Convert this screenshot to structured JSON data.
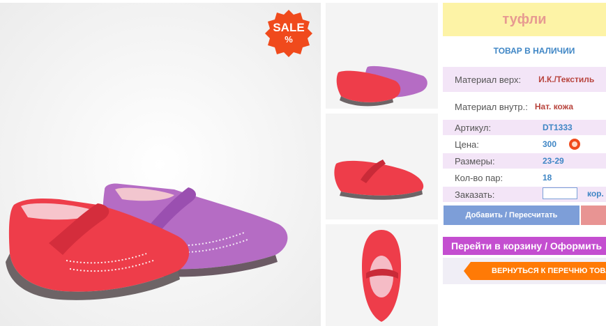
{
  "product": {
    "title": "туфли",
    "stock_status": "ТОВАР В НАЛИЧИИ"
  },
  "sale_badge": {
    "text": "SALE",
    "symbol": "%"
  },
  "specs": [
    {
      "label": "Материал верх:",
      "value": "И.К./Текстиль"
    },
    {
      "label": "Материал внутр.:",
      "value": "Нат. кожа"
    },
    {
      "label": "Артикул:",
      "value": "DT1333"
    },
    {
      "label": "Цена:",
      "value": "300"
    },
    {
      "label": "Размеры:",
      "value": "23-29"
    },
    {
      "label": "Кол-во пар:",
      "value": "18"
    }
  ],
  "order": {
    "label": "Заказать:",
    "value": "",
    "unit": "кор."
  },
  "buttons": {
    "add_recalc": "Добавить / Пересчитать",
    "go_to_cart": "Перейти в корзину / Оформить",
    "back_to_list": "ВЕРНУТЬСЯ К ПЕРЕЧНЮ ТОВАРОВ"
  },
  "colors": {
    "title_bg": "#fdf3a6",
    "title_text": "#e79a91",
    "accent_blue": "#3f86c5",
    "value_red": "#b8443d",
    "cart_purple": "#c44ed0",
    "back_orange": "#ff7a06",
    "shoe_red": "#ee3d4a",
    "shoe_purple": "#b56cc4"
  }
}
